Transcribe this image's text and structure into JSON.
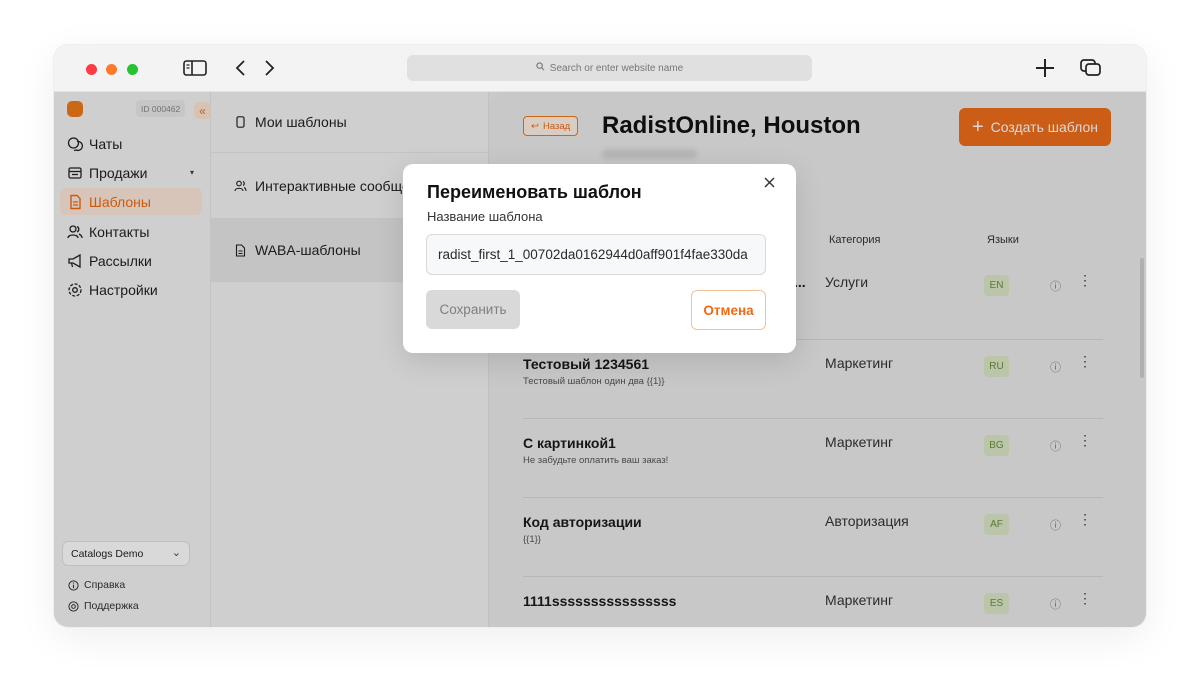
{
  "browser": {
    "address_placeholder": "Search or enter website name"
  },
  "sidebar": {
    "account_id": "ID 000462",
    "collapse_glyph": "«",
    "items": [
      {
        "label": "Чаты",
        "icon": "chat-icon",
        "active": false
      },
      {
        "label": "Продажи",
        "icon": "sales-icon",
        "active": false,
        "has_caret": true
      },
      {
        "label": "Шаблоны",
        "icon": "template-icon",
        "active": true
      },
      {
        "label": "Контакты",
        "icon": "contacts-icon",
        "active": false
      },
      {
        "label": "Рассылки",
        "icon": "megaphone-icon",
        "active": false
      },
      {
        "label": "Настройки",
        "icon": "settings-icon",
        "active": false
      }
    ],
    "catalog_select": "Catalogs Demo",
    "footer": [
      {
        "label": "Справка",
        "icon": "info-icon"
      },
      {
        "label": "Поддержка",
        "icon": "support-icon"
      }
    ]
  },
  "templates_panel": {
    "items": [
      {
        "label": "Мои шаблоны",
        "icon": "phone-icon",
        "active": false
      },
      {
        "label": "Интерактивные сообщения",
        "icon": "users-icon",
        "active": false
      },
      {
        "label": "WABA-шаблоны",
        "icon": "document-icon",
        "active": true
      }
    ]
  },
  "main": {
    "back_label": "Назад",
    "title": "RadistOnline, Houston",
    "create_label": "Создать шаблон",
    "columns": {
      "category": "Категория",
      "languages": "Языки"
    },
    "truncated_marker": "...",
    "rows": [
      {
        "name": "",
        "desc": "",
        "category": "Услуги",
        "lang": "EN"
      },
      {
        "name": "Тестовый 1234561",
        "desc": "Тестовый шаблон один два {{1}}",
        "category": "Маркетинг",
        "lang": "RU"
      },
      {
        "name": "С картинкой1",
        "desc": "Не забудьте оплатить ваш заказ!",
        "category": "Маркетинг",
        "lang": "BG"
      },
      {
        "name": "Код авторизации",
        "desc": "{{1}}",
        "category": "Авторизация",
        "lang": "AF"
      },
      {
        "name": "1111ssssssssssssssss",
        "desc": "",
        "category": "Маркетинг",
        "lang": "ES"
      }
    ],
    "info_glyph": "ⓘ",
    "more_glyph": "⋮"
  },
  "modal": {
    "title": "Переименовать шаблон",
    "field_label": "Название шаблона",
    "field_value": "radist_first_1_00702da0162944d0aff901f4fae330da",
    "save_label": "Сохранить",
    "cancel_label": "Отмена"
  },
  "colors": {
    "accent": "#ef6e1a",
    "accent_light": "#fde8da",
    "lang_badge_bg": "#dce8c7",
    "lang_badge_fg": "#6c8f3b"
  }
}
